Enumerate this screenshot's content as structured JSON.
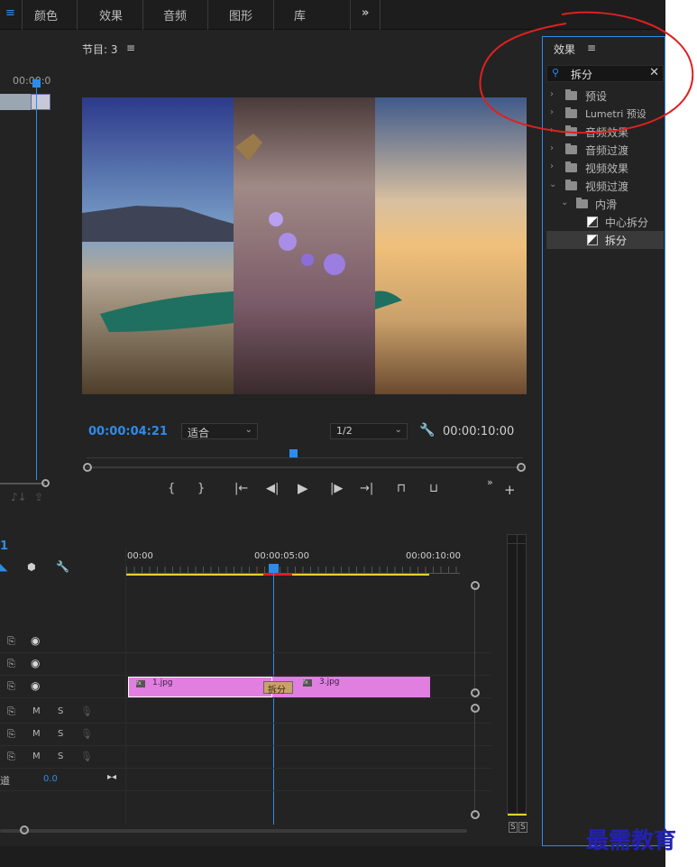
{
  "workspace": {
    "menu_label": "≡",
    "tabs": [
      "颜色",
      "效果",
      "音频",
      "图形",
      "库"
    ],
    "more": "»"
  },
  "source_monitor": {
    "timecode": "00:00:0"
  },
  "program_monitor": {
    "title": "节目: 3",
    "menu_icon": "≡",
    "current_time": "00:00:04:21",
    "fit": "适合",
    "resolution": "1/2",
    "duration": "00:00:10:00"
  },
  "effects": {
    "title": "效果",
    "menu_icon": "≡",
    "search_value": "拆分",
    "tree": [
      {
        "label": "预设",
        "type": "folder-star",
        "expanded": false
      },
      {
        "label": "Lumetri 预设",
        "type": "folder-star",
        "expanded": false
      },
      {
        "label": "音频效果",
        "type": "folder",
        "expanded": false
      },
      {
        "label": "音频过渡",
        "type": "folder",
        "expanded": false
      },
      {
        "label": "视频效果",
        "type": "folder",
        "expanded": false
      },
      {
        "label": "视频过渡",
        "type": "folder",
        "expanded": true
      },
      {
        "label": "内滑",
        "type": "folder",
        "expanded": true
      },
      {
        "label": "中心拆分",
        "type": "transition"
      },
      {
        "label": "拆分",
        "type": "transition",
        "selected": true
      }
    ]
  },
  "timeline": {
    "sequence_marker": "1",
    "ruler": [
      "00:00",
      "00:00:05:00",
      "00:00:10:00"
    ],
    "clips": [
      {
        "name": "1.jpg"
      },
      {
        "name": "3.jpg"
      }
    ],
    "transition_label": "拆分",
    "audio_controls": {
      "m": "M",
      "s": "S"
    },
    "master_label": "道",
    "master_value": "0.0"
  },
  "meter": {
    "solo": [
      "S",
      "S"
    ]
  },
  "watermark": "最需教育",
  "colors": {
    "accent": "#2d8ceb",
    "clip": "#e07fe0",
    "annotation": "#e02020"
  }
}
